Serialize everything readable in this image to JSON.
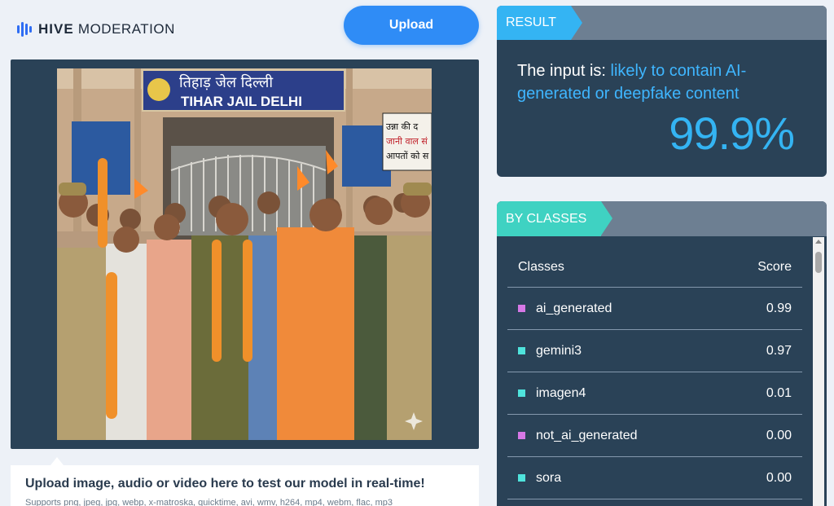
{
  "header": {
    "brand_bold": "HIVE",
    "brand_rest": " MODERATION",
    "upload_label": "Upload"
  },
  "preview": {
    "sign_hindi": "तिहाड़ जेल दिल्ली",
    "sign_english": "TIHAR JAIL DELHI",
    "placard_line1": "उन्ना की द",
    "placard_line2": "जानी वाल सं",
    "placard_line3": "आपतों को स"
  },
  "upload_info": {
    "title": "Upload image, audio or video here to test our model in real-time!",
    "supports": "Supports png, jpeg, jpg, webp, x-matroska, quicktime, avi, wmv, h264, mp4, webm, flac, mp3"
  },
  "result": {
    "tag": "RESULT",
    "prefix": "The input is: ",
    "verdict": "likely to contain AI-generated or deepfake content",
    "score": "99.9%"
  },
  "by_classes": {
    "tag": "BY CLASSES",
    "col_classes": "Classes",
    "col_score": "Score",
    "rows": [
      {
        "name": "ai_generated",
        "score": "0.99",
        "color": "#d678e6"
      },
      {
        "name": "gemini3",
        "score": "0.97",
        "color": "#4fe3dc"
      },
      {
        "name": "imagen4",
        "score": "0.01",
        "color": "#4fe3dc"
      },
      {
        "name": "not_ai_generated",
        "score": "0.00",
        "color": "#d678e6"
      },
      {
        "name": "sora",
        "score": "0.00",
        "color": "#4fe3dc"
      }
    ]
  },
  "colors": {
    "accent": "#34b4f3",
    "panel": "#2a4257",
    "button": "#2f8cf6"
  }
}
